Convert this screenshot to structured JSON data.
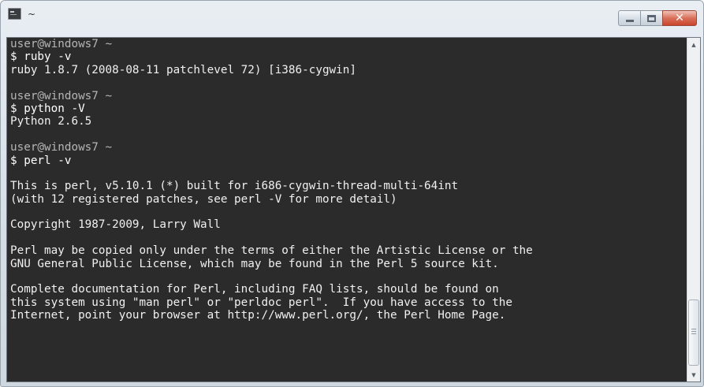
{
  "window": {
    "title": "~",
    "caption": {
      "minimize_icon": "minimize-icon",
      "maximize_icon": "maximize-icon",
      "close_icon": "close-icon",
      "close_glyph": "✕"
    }
  },
  "terminal": {
    "background": "#2b2b2b",
    "foreground": "#f0f0f0",
    "lines": [
      {
        "kind": "prompt",
        "text": "user@windows7 ~"
      },
      {
        "kind": "cmd",
        "text": "$ ruby -v"
      },
      {
        "kind": "output",
        "text": "ruby 1.8.7 (2008-08-11 patchlevel 72) [i386-cygwin]"
      },
      {
        "kind": "blank",
        "text": ""
      },
      {
        "kind": "prompt",
        "text": "user@windows7 ~"
      },
      {
        "kind": "cmd",
        "text": "$ python -V"
      },
      {
        "kind": "output",
        "text": "Python 2.6.5"
      },
      {
        "kind": "blank",
        "text": ""
      },
      {
        "kind": "prompt",
        "text": "user@windows7 ~"
      },
      {
        "kind": "cmd",
        "text": "$ perl -v"
      },
      {
        "kind": "blank",
        "text": ""
      },
      {
        "kind": "output",
        "text": "This is perl, v5.10.1 (*) built for i686-cygwin-thread-multi-64int"
      },
      {
        "kind": "output",
        "text": "(with 12 registered patches, see perl -V for more detail)"
      },
      {
        "kind": "blank",
        "text": ""
      },
      {
        "kind": "output",
        "text": "Copyright 1987-2009, Larry Wall"
      },
      {
        "kind": "blank",
        "text": ""
      },
      {
        "kind": "output",
        "text": "Perl may be copied only under the terms of either the Artistic License or the"
      },
      {
        "kind": "output",
        "text": "GNU General Public License, which may be found in the Perl 5 source kit."
      },
      {
        "kind": "blank",
        "text": ""
      },
      {
        "kind": "output",
        "text": "Complete documentation for Perl, including FAQ lists, should be found on"
      },
      {
        "kind": "output",
        "text": "this system using \"man perl\" or \"perldoc perl\".  If you have access to the"
      },
      {
        "kind": "output",
        "text": "Internet, point your browser at http://www.perl.org/, the Perl Home Page."
      }
    ]
  },
  "scrollbar": {
    "up_glyph": "▲",
    "down_glyph": "▼",
    "position": 0.95
  }
}
